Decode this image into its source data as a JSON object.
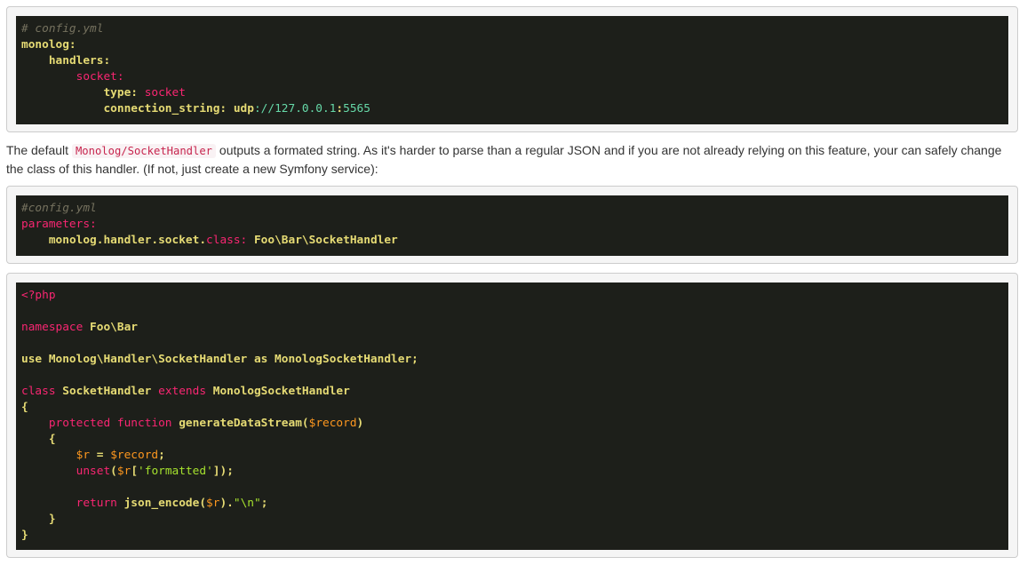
{
  "block1": {
    "lines": [
      {
        "t": [
          {
            "c": "c-comment",
            "s": "# config.yml"
          }
        ]
      },
      {
        "t": [
          {
            "c": "c-key",
            "s": "monolog:"
          }
        ]
      },
      {
        "t": [
          {
            "c": "c-plain",
            "s": "    "
          },
          {
            "c": "c-key",
            "s": "handlers:"
          }
        ]
      },
      {
        "t": [
          {
            "c": "c-plain",
            "s": "        "
          },
          {
            "c": "c-red",
            "s": "socket:"
          }
        ]
      },
      {
        "t": [
          {
            "c": "c-plain",
            "s": "            "
          },
          {
            "c": "c-key",
            "s": "type: "
          },
          {
            "c": "c-red",
            "s": "socket"
          }
        ]
      },
      {
        "t": [
          {
            "c": "c-plain",
            "s": "            "
          },
          {
            "c": "c-key",
            "s": "connection_string: "
          },
          {
            "c": "c-key",
            "s": "udp"
          },
          {
            "c": "c-url",
            "s": "://127.0.0.1"
          },
          {
            "c": "c-key",
            "s": ":"
          },
          {
            "c": "c-url",
            "s": "5565"
          }
        ]
      }
    ]
  },
  "paragraph": {
    "before": "The default ",
    "code": "Monolog/SocketHandler",
    "after": " outputs a formated string. As it's harder to parse than a regular JSON and if you are not already relying on this feature, your can safely change the class of this handler. (If not, just create a new Symfony service):"
  },
  "block2": {
    "lines": [
      {
        "t": [
          {
            "c": "c-comment",
            "s": "#config.yml"
          }
        ]
      },
      {
        "t": [
          {
            "c": "c-red",
            "s": "parameters:"
          }
        ]
      },
      {
        "t": [
          {
            "c": "c-plain",
            "s": "    "
          },
          {
            "c": "c-key",
            "s": "monolog.handler.socket."
          },
          {
            "c": "c-red",
            "s": "class: "
          },
          {
            "c": "c-key",
            "s": "Foo\\Bar\\SocketHandler"
          }
        ]
      }
    ]
  },
  "block3": {
    "lines": [
      {
        "t": [
          {
            "c": "c-red",
            "s": "<?php"
          }
        ]
      },
      {
        "t": []
      },
      {
        "t": [
          {
            "c": "c-red",
            "s": "namespace "
          },
          {
            "c": "c-bold-y",
            "s": "Foo\\Bar"
          }
        ]
      },
      {
        "t": []
      },
      {
        "t": [
          {
            "c": "c-bold-y",
            "s": "use Monolog\\Handler\\SocketHandler as MonologSocketHandler;"
          }
        ]
      },
      {
        "t": []
      },
      {
        "t": [
          {
            "c": "c-red",
            "s": "class "
          },
          {
            "c": "c-key",
            "s": "SocketHandler "
          },
          {
            "c": "c-red",
            "s": "extends "
          },
          {
            "c": "c-key",
            "s": "MonologSocketHandler"
          }
        ]
      },
      {
        "t": [
          {
            "c": "c-bold-y",
            "s": "{"
          }
        ]
      },
      {
        "t": [
          {
            "c": "c-plain",
            "s": "    "
          },
          {
            "c": "c-red",
            "s": "protected function "
          },
          {
            "c": "c-bold-y",
            "s": "generateDataStream("
          },
          {
            "c": "c-var",
            "s": "$record"
          },
          {
            "c": "c-bold-y",
            "s": ")"
          }
        ]
      },
      {
        "t": [
          {
            "c": "c-plain",
            "s": "    "
          },
          {
            "c": "c-bold-y",
            "s": "{"
          }
        ]
      },
      {
        "t": [
          {
            "c": "c-plain",
            "s": "        "
          },
          {
            "c": "c-var",
            "s": "$r"
          },
          {
            "c": "c-bold-y",
            "s": " = "
          },
          {
            "c": "c-var",
            "s": "$record"
          },
          {
            "c": "c-bold-y",
            "s": ";"
          }
        ]
      },
      {
        "t": [
          {
            "c": "c-plain",
            "s": "        "
          },
          {
            "c": "c-red",
            "s": "unset"
          },
          {
            "c": "c-bold-y",
            "s": "("
          },
          {
            "c": "c-var",
            "s": "$r"
          },
          {
            "c": "c-bold-y",
            "s": "["
          },
          {
            "c": "c-str",
            "s": "'formatted'"
          },
          {
            "c": "c-bold-y",
            "s": "]);"
          }
        ]
      },
      {
        "t": []
      },
      {
        "t": [
          {
            "c": "c-plain",
            "s": "        "
          },
          {
            "c": "c-red",
            "s": "return "
          },
          {
            "c": "c-bold-y",
            "s": "json_encode("
          },
          {
            "c": "c-var",
            "s": "$r"
          },
          {
            "c": "c-bold-y",
            "s": ")."
          },
          {
            "c": "c-str",
            "s": "\"\\n\""
          },
          {
            "c": "c-bold-y",
            "s": ";"
          }
        ]
      },
      {
        "t": [
          {
            "c": "c-plain",
            "s": "    "
          },
          {
            "c": "c-bold-y",
            "s": "}"
          }
        ]
      },
      {
        "t": [
          {
            "c": "c-bold-y",
            "s": "}"
          }
        ]
      }
    ]
  }
}
